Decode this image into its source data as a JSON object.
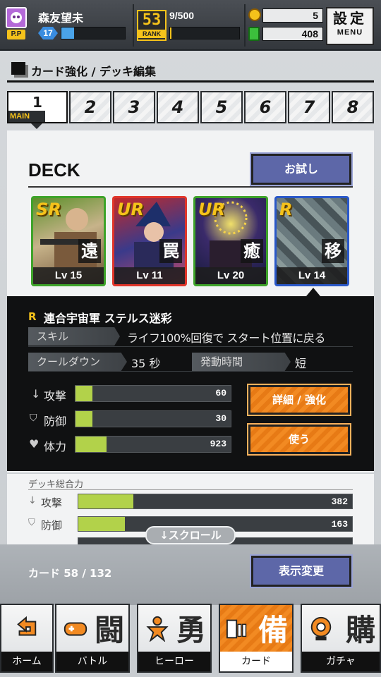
{
  "status": {
    "player_name": "森友望未",
    "player_level": "17",
    "rank_value": "53",
    "rank_label": "RANK",
    "rank_exp": "9/500",
    "currency_coin": "5",
    "currency_gem": "408",
    "settings_label": "設定",
    "menu_label": "MENU"
  },
  "header": {
    "title": "カード強化 / デッキ編集"
  },
  "deck_tabs": [
    {
      "label": "1",
      "sub": "MAIN"
    },
    {
      "label": "2"
    },
    {
      "label": "3"
    },
    {
      "label": "4"
    },
    {
      "label": "5"
    },
    {
      "label": "6"
    },
    {
      "label": "7"
    },
    {
      "label": "8"
    }
  ],
  "deck": {
    "title": "DECK",
    "try_button": "お試し",
    "cards": [
      {
        "rarity": "SR",
        "kanji": "遠",
        "level": "Lv 15"
      },
      {
        "rarity": "UR",
        "kanji": "罠",
        "level": "Lv 11"
      },
      {
        "rarity": "UR",
        "kanji": "癒",
        "level": "Lv 20"
      },
      {
        "rarity": "R",
        "kanji": "移",
        "level": "Lv 14"
      }
    ]
  },
  "detail": {
    "rarity": "R",
    "name": "連合宇宙軍 ステルス迷彩",
    "skill_label": "スキル",
    "skill_text": "ライフ100%回復で スタート位置に戻る",
    "cooldown_label": "クールダウン",
    "cooldown_value": "35 秒",
    "trigger_label": "発動時間",
    "trigger_value": "短",
    "stats": [
      {
        "label": "攻撃",
        "value": "60",
        "fill": 0.11
      },
      {
        "label": "防御",
        "value": "30",
        "fill": 0.11
      },
      {
        "label": "体力",
        "value": "923",
        "fill": 0.2
      }
    ],
    "detail_button": "詳細 / 強化",
    "use_button": "使う"
  },
  "total": {
    "title": "デッキ総合力",
    "stats": [
      {
        "label": "攻撃",
        "value": "382",
        "fill": 0.2
      },
      {
        "label": "防御",
        "value": "163",
        "fill": 0.17
      }
    ],
    "scroll_hint": "↓スクロール"
  },
  "footer": {
    "card_count": "カード 58 / 132",
    "display_button": "表示変更"
  },
  "nav": [
    {
      "label": "ホーム",
      "big": ""
    },
    {
      "label": "バトル",
      "big": "闘"
    },
    {
      "label": "ヒーロー",
      "big": "勇"
    },
    {
      "label": "カード",
      "big": "備"
    },
    {
      "label": "ガチャ",
      "big": "購"
    }
  ],
  "colors": {
    "accent_orange": "#f28a22",
    "stat_green": "#b2d24a",
    "button_blue": "#5d67a8"
  }
}
